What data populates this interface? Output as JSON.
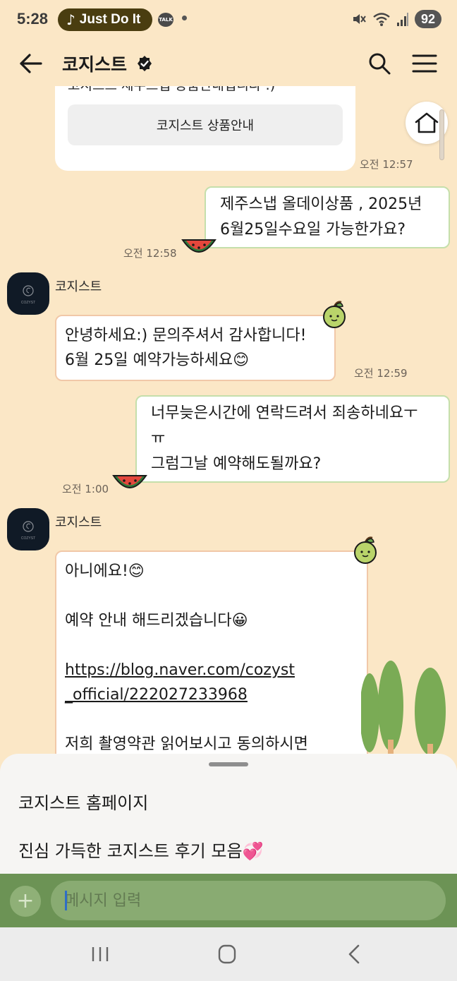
{
  "status_bar": {
    "time": "5:28",
    "media_label": "Just Do It",
    "talk_badge": "TALK",
    "battery": "92"
  },
  "header": {
    "title": "코지스트"
  },
  "messages": {
    "card_text": "코지스트 제주스냅 상품안내입니다 :)",
    "card_button": "코지스트 상품안내",
    "card_time": "오전 12:57",
    "out1_lines": [
      "제주스냅 올데이상품 , 2025년",
      "6월25일수요일 가능한가요?"
    ],
    "out1_time": "오전 12:58",
    "in1_sender": "코지스트",
    "in1_lines": [
      "안녕하세요:) 문의주셔서 감사합니다!",
      "6월 25일 예약가능하세요😊"
    ],
    "in1_time": "오전 12:59",
    "out2_lines": [
      "너무늦은시간에 연락드려서 죄송하네요ㅜ",
      "ㅠ",
      "그럼그날 예약해도될까요?"
    ],
    "out2_time": "오전 1:00",
    "in2_sender": "코지스트",
    "in2_line1": "아니에요!😊",
    "in2_line2": "예약 안내 해드리겠습니다😀",
    "in2_link1": "https://blog.naver.com/cozyst",
    "in2_link2": "_official/222027233968",
    "in2_line3": "저희 촬영약관 읽어보시고 동의하시면"
  },
  "avatar_text": "COZYST",
  "quick_menu": {
    "items": [
      "코지스트 홈페이지",
      "진심 가득한 코지스트 후기 모음💞"
    ]
  },
  "input": {
    "placeholder": "메시지 입력"
  },
  "colors": {
    "background": "#fbe7c6",
    "outgoing_border": "#c5dfab",
    "incoming_border": "#f1c8a8",
    "input_bar": "#6c9355"
  }
}
